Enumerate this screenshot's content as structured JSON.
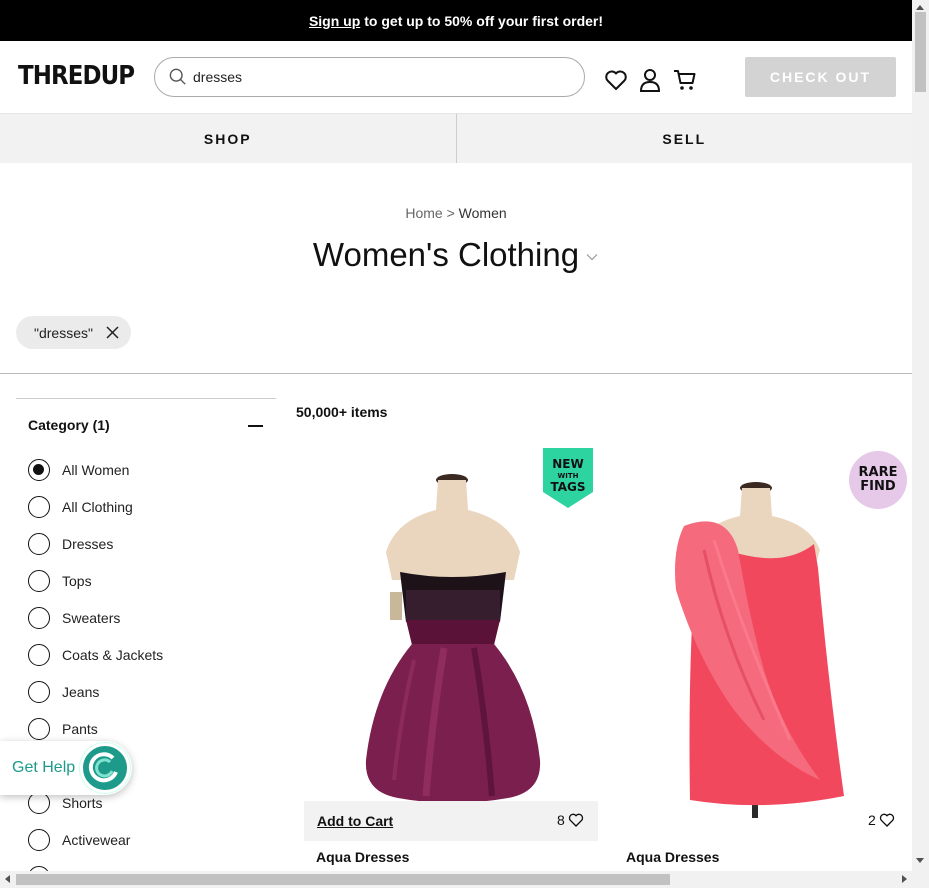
{
  "promo": {
    "link": "Sign up",
    "text": "to get up to 50% off your first order!"
  },
  "header": {
    "logo": "THREDUP",
    "search_value": "dresses",
    "checkout_label": "CHECK OUT"
  },
  "nav": {
    "shop": "SHOP",
    "sell": "SELL"
  },
  "breadcrumb": {
    "home": "Home",
    "sep": ">",
    "current": "Women"
  },
  "page_title": "Women's Clothing",
  "filter_chip": "\"dresses\"",
  "results_count": "50,000+ items",
  "sidebar": {
    "heading": "Category (1)",
    "items": [
      {
        "label": "All Women",
        "selected": true
      },
      {
        "label": "All Clothing",
        "selected": false
      },
      {
        "label": "Dresses",
        "selected": false
      },
      {
        "label": "Tops",
        "selected": false
      },
      {
        "label": "Sweaters",
        "selected": false
      },
      {
        "label": "Coats & Jackets",
        "selected": false
      },
      {
        "label": "Jeans",
        "selected": false
      },
      {
        "label": "Pants",
        "selected": false
      },
      {
        "label": "",
        "selected": false
      },
      {
        "label": "Shorts",
        "selected": false
      },
      {
        "label": "Activewear",
        "selected": false
      }
    ]
  },
  "products": [
    {
      "brand": "Aqua Dresses",
      "likes": "8",
      "badge": "NEW WITH TAGS",
      "add_to_cart": "Add to Cart",
      "color": "#7a1f4e"
    },
    {
      "brand": "Aqua Dresses",
      "likes": "2",
      "badge": "RARE FIND",
      "color": "#f2485e"
    }
  ],
  "get_help": "Get Help",
  "colors": {
    "accent": "#1d9a8a",
    "checkout_bg": "#d3d3d3",
    "new_badge": "#2ed4a0",
    "rare_badge": "#e6c8e8"
  }
}
